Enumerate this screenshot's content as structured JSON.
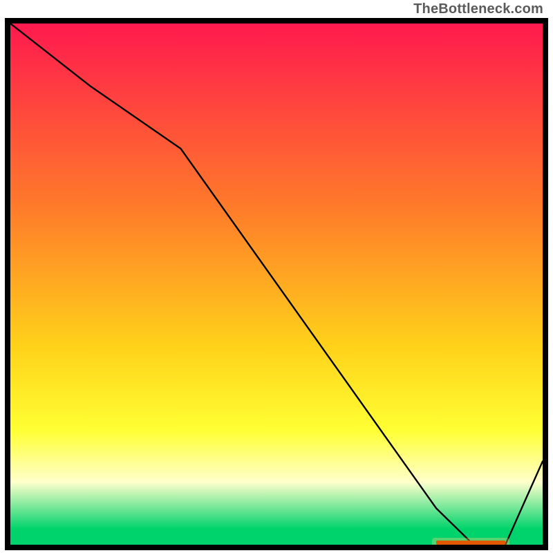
{
  "credit": "TheBottleneck.com",
  "colors": {
    "top": "#ff1a4e",
    "mid1": "#ff7a2a",
    "mid2": "#ffd21a",
    "mid3": "#ffff33",
    "pale": "#ffffcc",
    "green": "#00d36b",
    "border": "#000000",
    "line": "#000000",
    "marker": "#e25a00",
    "marker_glow": "#ffd080"
  },
  "chart_data": {
    "type": "line",
    "title": "",
    "xlabel": "",
    "ylabel": "",
    "xlim": [
      0,
      100
    ],
    "ylim": [
      0,
      100
    ],
    "grid": false,
    "legend": false,
    "series": [
      {
        "name": "bottleneck-curve",
        "x": [
          0,
          15,
          32,
          80,
          87,
          93,
          100
        ],
        "y": [
          100,
          88,
          76,
          7,
          0,
          0,
          16
        ]
      }
    ],
    "annotations": [
      {
        "type": "marker-segment",
        "x0": 80,
        "x1": 93,
        "y": 0
      }
    ],
    "gradient_stops_pct": [
      {
        "pct": 0,
        "key": "top"
      },
      {
        "pct": 35,
        "key": "mid1"
      },
      {
        "pct": 62,
        "key": "mid2"
      },
      {
        "pct": 78,
        "key": "mid3"
      },
      {
        "pct": 88,
        "key": "pale"
      },
      {
        "pct": 97,
        "key": "green"
      },
      {
        "pct": 100,
        "key": "green"
      }
    ]
  },
  "geometry": {
    "outer_x": 7,
    "outer_y": 26,
    "outer_w": 786,
    "outer_h": 770,
    "border_width": 8
  }
}
